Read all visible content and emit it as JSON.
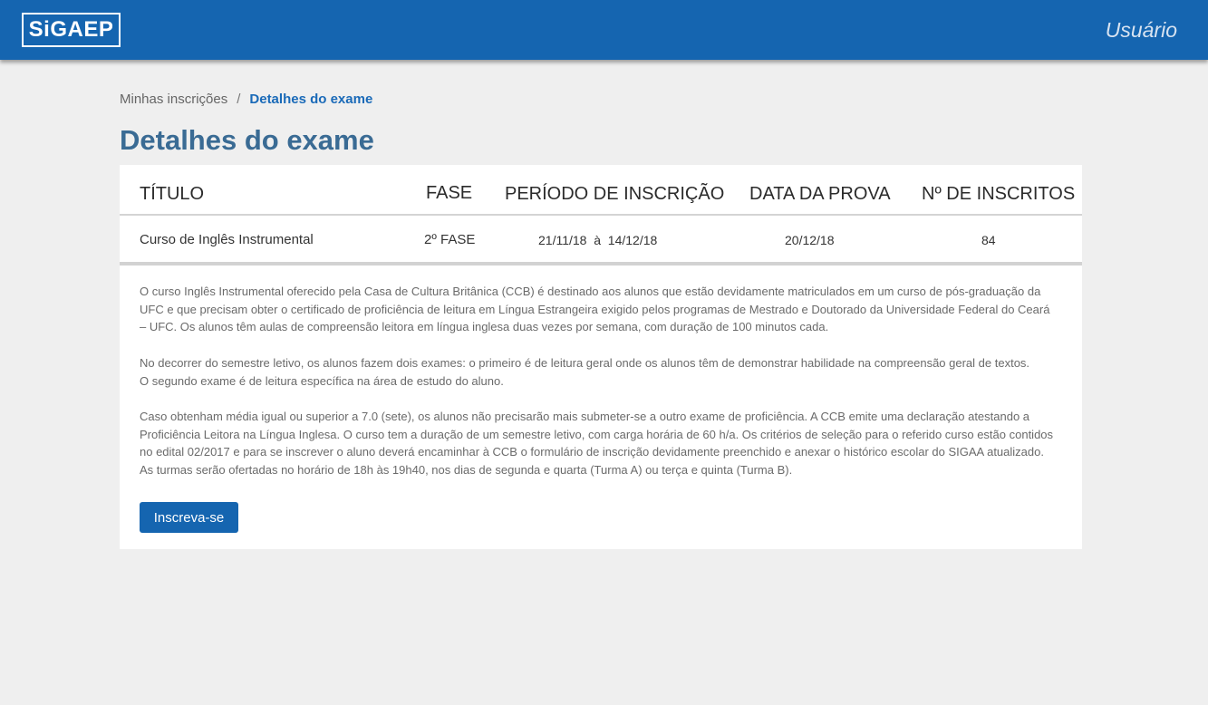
{
  "header": {
    "logo": "SiGAEP",
    "user_menu": "Usuário",
    "background_color": "#1565b0"
  },
  "breadcrumb": {
    "link": "Minhas inscrições",
    "separator": "/",
    "current": "Detalhes do exame"
  },
  "page_title": "Detalhes do exame",
  "table": {
    "columns": [
      "TÍTULO",
      "FASE",
      "PERÍODO DE INSCRIÇÃO",
      "DATA DA PROVA",
      "Nº DE INSCRITOS"
    ],
    "row": {
      "title": "Curso de Inglês Instrumental",
      "phase": "2º FASE",
      "period": "21/11/18  à  14/12/18",
      "exam_date": "20/12/18",
      "enrolled": "84"
    }
  },
  "description": {
    "paragraph_1_line_1": "O curso Inglês Instrumental oferecido pela Casa de Cultura Britânica (CCB) é destinado aos alunos que estão devidamente matriculados em um curso de pós-graduação da",
    "paragraph_1_line_2": "UFC e que precisam obter o certificado de proficiência de leitura em Língua Estrangeira exigido pelos programas de Mestrado e Doutorado da Universidade Federal do Ceará",
    "paragraph_1_line_3": "– UFC. Os alunos têm aulas de compreensão leitora em língua inglesa duas vezes por semana, com duração de 100 minutos cada.",
    "paragraph_2_line_1": "No decorrer do semestre letivo, os alunos fazem dois exames: o primeiro é de leitura geral onde os alunos têm de demonstrar habilidade na compreensão geral de textos.",
    "paragraph_2_line_2": "O segundo exame é de leitura específica na área de estudo do aluno.",
    "paragraph_3_line_1": "Caso obtenham média igual ou superior a 7.0 (sete), os alunos não precisarão mais submeter-se a outro exame de proficiência. A CCB emite uma declaração atestando a",
    "paragraph_3_line_2": "Proficiência Leitora na Língua Inglesa. O curso tem a duração de um semestre letivo, com carga horária de 60 h/a. Os critérios de seleção para o referido curso estão contidos",
    "paragraph_3_line_3": "no edital 02/2017 e para se inscrever o aluno deverá encaminhar à CCB o formulário de inscrição devidamente preenchido e anexar o histórico escolar do SIGAA atualizado.",
    "paragraph_3_line_4": "As turmas serão ofertadas no horário de 18h às 19h40, nos dias de segunda e quarta (Turma A) ou terça e quinta (Turma B)."
  },
  "actions": {
    "enroll_button": "Inscreva-se"
  }
}
